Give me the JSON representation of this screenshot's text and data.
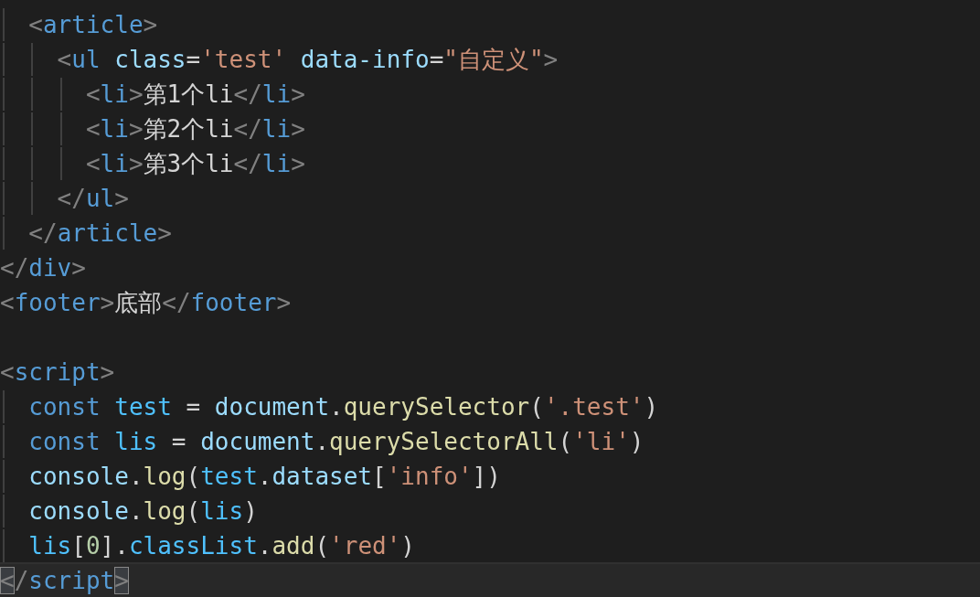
{
  "editor": {
    "lines": [
      {
        "current": false,
        "tokens": [
          {
            "text": "  <",
            "kind": "punct"
          },
          {
            "text": "article",
            "kind": "tag"
          },
          {
            "text": ">",
            "kind": "punct"
          }
        ]
      },
      {
        "current": false,
        "tokens": [
          {
            "text": "    <",
            "kind": "punct"
          },
          {
            "text": "ul",
            "kind": "tag"
          },
          {
            "text": " class",
            "kind": "attr"
          },
          {
            "text": "=",
            "kind": "plain"
          },
          {
            "text": "'test'",
            "kind": "string"
          },
          {
            "text": " data-info",
            "kind": "attr"
          },
          {
            "text": "=",
            "kind": "plain"
          },
          {
            "text": "\"自定义\"",
            "kind": "string"
          },
          {
            "text": ">",
            "kind": "punct"
          }
        ]
      },
      {
        "current": false,
        "tokens": [
          {
            "text": "      <",
            "kind": "punct"
          },
          {
            "text": "li",
            "kind": "tag"
          },
          {
            "text": ">",
            "kind": "punct"
          },
          {
            "text": "第1个li",
            "kind": "plain"
          },
          {
            "text": "</",
            "kind": "punct"
          },
          {
            "text": "li",
            "kind": "tag"
          },
          {
            "text": ">",
            "kind": "punct"
          }
        ]
      },
      {
        "current": false,
        "tokens": [
          {
            "text": "      <",
            "kind": "punct"
          },
          {
            "text": "li",
            "kind": "tag"
          },
          {
            "text": ">",
            "kind": "punct"
          },
          {
            "text": "第2个li",
            "kind": "plain"
          },
          {
            "text": "</",
            "kind": "punct"
          },
          {
            "text": "li",
            "kind": "tag"
          },
          {
            "text": ">",
            "kind": "punct"
          }
        ]
      },
      {
        "current": false,
        "tokens": [
          {
            "text": "      <",
            "kind": "punct"
          },
          {
            "text": "li",
            "kind": "tag"
          },
          {
            "text": ">",
            "kind": "punct"
          },
          {
            "text": "第3个li",
            "kind": "plain"
          },
          {
            "text": "</",
            "kind": "punct"
          },
          {
            "text": "li",
            "kind": "tag"
          },
          {
            "text": ">",
            "kind": "punct"
          }
        ]
      },
      {
        "current": false,
        "tokens": [
          {
            "text": "    </",
            "kind": "punct"
          },
          {
            "text": "ul",
            "kind": "tag"
          },
          {
            "text": ">",
            "kind": "punct"
          }
        ]
      },
      {
        "current": false,
        "tokens": [
          {
            "text": "  </",
            "kind": "punct"
          },
          {
            "text": "article",
            "kind": "tag"
          },
          {
            "text": ">",
            "kind": "punct"
          }
        ]
      },
      {
        "current": false,
        "tokens": [
          {
            "text": "</",
            "kind": "punct"
          },
          {
            "text": "div",
            "kind": "tag"
          },
          {
            "text": ">",
            "kind": "punct"
          }
        ]
      },
      {
        "current": false,
        "tokens": [
          {
            "text": "<",
            "kind": "punct"
          },
          {
            "text": "footer",
            "kind": "tag"
          },
          {
            "text": ">",
            "kind": "punct"
          },
          {
            "text": "底部",
            "kind": "plain"
          },
          {
            "text": "</",
            "kind": "punct"
          },
          {
            "text": "footer",
            "kind": "tag"
          },
          {
            "text": ">",
            "kind": "punct"
          }
        ]
      },
      {
        "current": false
      },
      {
        "current": false,
        "tokens": [
          {
            "text": "<",
            "kind": "punct"
          },
          {
            "text": "script",
            "kind": "tag"
          },
          {
            "text": ">",
            "kind": "punct"
          }
        ]
      },
      {
        "current": false,
        "tokens": [
          {
            "text": "  const ",
            "kind": "keyword"
          },
          {
            "text": "test",
            "kind": "constant"
          },
          {
            "text": " = ",
            "kind": "plain"
          },
          {
            "text": "document",
            "kind": "variable"
          },
          {
            "text": ".",
            "kind": "plain"
          },
          {
            "text": "querySelector",
            "kind": "function"
          },
          {
            "text": "(",
            "kind": "plain"
          },
          {
            "text": "'.test'",
            "kind": "string"
          },
          {
            "text": ")",
            "kind": "plain"
          }
        ]
      },
      {
        "current": false,
        "tokens": [
          {
            "text": "  const ",
            "kind": "keyword"
          },
          {
            "text": "lis",
            "kind": "constant"
          },
          {
            "text": " = ",
            "kind": "plain"
          },
          {
            "text": "document",
            "kind": "variable"
          },
          {
            "text": ".",
            "kind": "plain"
          },
          {
            "text": "querySelectorAll",
            "kind": "function"
          },
          {
            "text": "(",
            "kind": "plain"
          },
          {
            "text": "'li'",
            "kind": "string"
          },
          {
            "text": ")",
            "kind": "plain"
          }
        ]
      },
      {
        "current": false,
        "tokens": [
          {
            "text": "  console",
            "kind": "variable"
          },
          {
            "text": ".",
            "kind": "plain"
          },
          {
            "text": "log",
            "kind": "function"
          },
          {
            "text": "(",
            "kind": "plain"
          },
          {
            "text": "test",
            "kind": "constant"
          },
          {
            "text": ".",
            "kind": "plain"
          },
          {
            "text": "dataset",
            "kind": "variable"
          },
          {
            "text": "[",
            "kind": "plain"
          },
          {
            "text": "'info'",
            "kind": "string"
          },
          {
            "text": "])",
            "kind": "plain"
          }
        ]
      },
      {
        "current": false,
        "tokens": [
          {
            "text": "  console",
            "kind": "variable"
          },
          {
            "text": ".",
            "kind": "plain"
          },
          {
            "text": "log",
            "kind": "function"
          },
          {
            "text": "(",
            "kind": "plain"
          },
          {
            "text": "lis",
            "kind": "constant"
          },
          {
            "text": ")",
            "kind": "plain"
          }
        ]
      },
      {
        "current": false,
        "tokens": [
          {
            "text": "  lis",
            "kind": "constant"
          },
          {
            "text": "[",
            "kind": "plain"
          },
          {
            "text": "0",
            "kind": "number"
          },
          {
            "text": "].",
            "kind": "plain"
          },
          {
            "text": "classList",
            "kind": "property"
          },
          {
            "text": ".",
            "kind": "plain"
          },
          {
            "text": "add",
            "kind": "function"
          },
          {
            "text": "(",
            "kind": "plain"
          },
          {
            "text": "'red'",
            "kind": "string"
          },
          {
            "text": ")",
            "kind": "plain"
          }
        ]
      },
      {
        "current": true,
        "tokens": [
          {
            "text": "<",
            "kind": "bracket"
          },
          {
            "text": "/",
            "kind": "punct"
          },
          {
            "text": "script",
            "kind": "tag"
          },
          {
            "text": ">",
            "kind": "bracket"
          }
        ]
      }
    ]
  }
}
